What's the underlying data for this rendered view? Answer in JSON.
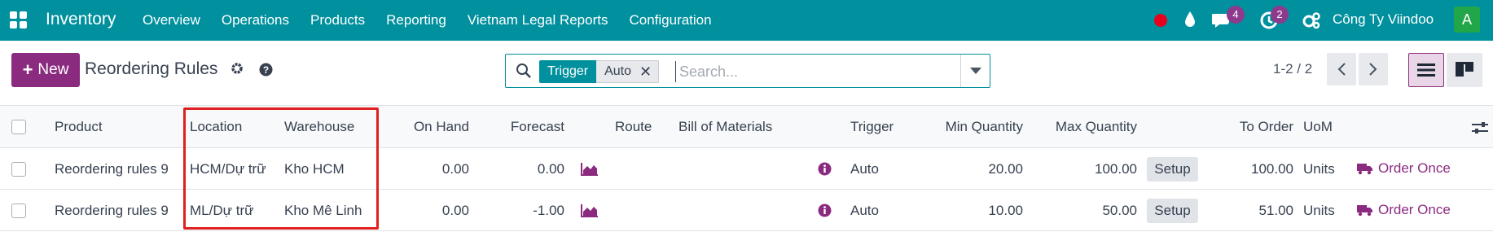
{
  "navbar": {
    "app_name": "Inventory",
    "menu": [
      "Overview",
      "Operations",
      "Products",
      "Reporting",
      "Vietnam Legal Reports",
      "Configuration"
    ],
    "chat_badge": "4",
    "activity_badge": "2",
    "company": "Công Ty Viindoo",
    "avatar_letter": "A",
    "colors": {
      "navbar_bg": "#00909e",
      "badge": "#8e3a8c",
      "status_dot": "#e8001c",
      "avatar": "#21a64a"
    }
  },
  "control": {
    "new_label": "New",
    "page_title": "Reordering Rules",
    "search": {
      "facet_label": "Trigger",
      "facet_value": "Auto",
      "placeholder": "Search..."
    },
    "pager": "1-2 / 2"
  },
  "table": {
    "headers": {
      "product": "Product",
      "location": "Location",
      "warehouse": "Warehouse",
      "on_hand": "On Hand",
      "forecast": "Forecast",
      "route": "Route",
      "bom": "Bill of Materials",
      "trigger": "Trigger",
      "min_qty": "Min Quantity",
      "max_qty": "Max Quantity",
      "to_order": "To Order",
      "uom": "UoM"
    },
    "rows": [
      {
        "product": "Reordering rules 9",
        "location": "HCM/Dự trữ",
        "warehouse": "Kho HCM",
        "on_hand": "0.00",
        "forecast": "0.00",
        "trigger": "Auto",
        "min_qty": "20.00",
        "max_qty": "100.00",
        "setup": "Setup",
        "to_order": "100.00",
        "uom": "Units",
        "action": "Order Once"
      },
      {
        "product": "Reordering rules 9",
        "location": "ML/Dự trữ",
        "warehouse": "Kho Mê Linh",
        "on_hand": "0.00",
        "forecast": "-1.00",
        "trigger": "Auto",
        "min_qty": "10.00",
        "max_qty": "50.00",
        "setup": "Setup",
        "to_order": "51.00",
        "uom": "Units",
        "action": "Order Once"
      }
    ],
    "colors": {
      "accent": "#8b2b80",
      "highlight": "#e02020"
    }
  }
}
